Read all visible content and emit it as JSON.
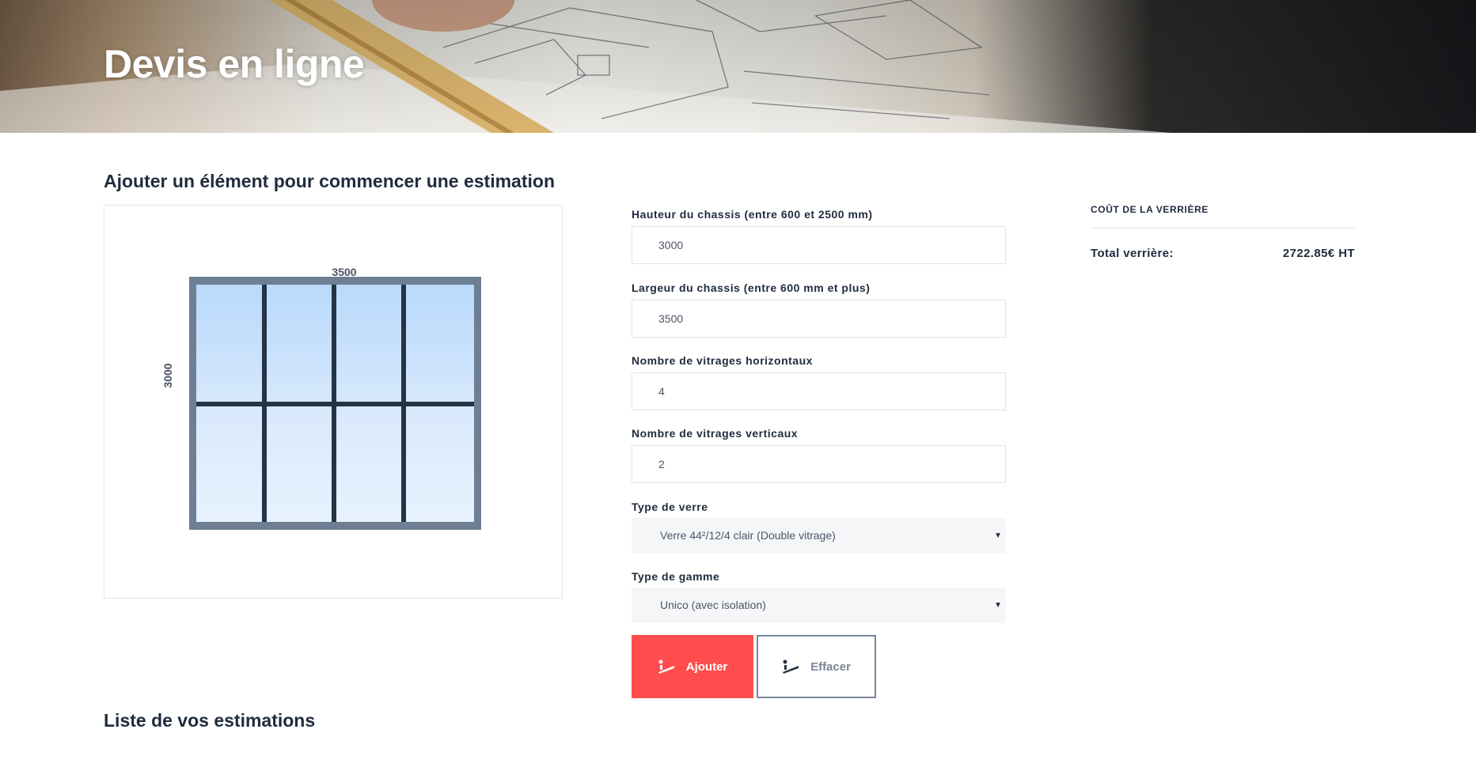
{
  "header": {
    "title": "Devis en ligne"
  },
  "builder": {
    "section_title": "Ajouter un élément pour commencer une estimation",
    "preview": {
      "width_label": "3500",
      "height_label": "3000",
      "columns": 4,
      "rows": 2
    },
    "fields": {
      "height": {
        "label": "Hauteur du chassis (entre 600 et 2500 mm)",
        "value": "3000"
      },
      "width": {
        "label": "Largeur du chassis (entre 600 mm et plus)",
        "value": "3500"
      },
      "horizontal": {
        "label": "Nombre de vitrages horizontaux",
        "value": "4"
      },
      "vertical": {
        "label": "Nombre de vitrages verticaux",
        "value": "2"
      },
      "glass_type": {
        "label": "Type de verre",
        "selected": "Verre 44²/12/4 clair (Double vitrage)"
      },
      "range_type": {
        "label": "Type de gamme",
        "selected": "Unico (avec isolation)"
      }
    },
    "buttons": {
      "add": "Ajouter",
      "clear": "Effacer"
    }
  },
  "cost": {
    "title": "COÛT DE LA VERRIÈRE",
    "total_label": "Total verrière:",
    "total_value": "2722.85€ HT"
  },
  "estimates": {
    "section_title": "Liste de vos estimations"
  },
  "colors": {
    "accent": "#ff4c4c",
    "frame": "#6f7f93",
    "mullion": "#243446",
    "glass_top": "#bddcfb",
    "glass_bottom": "#e6f1fd",
    "text": "#1f2b3d"
  }
}
